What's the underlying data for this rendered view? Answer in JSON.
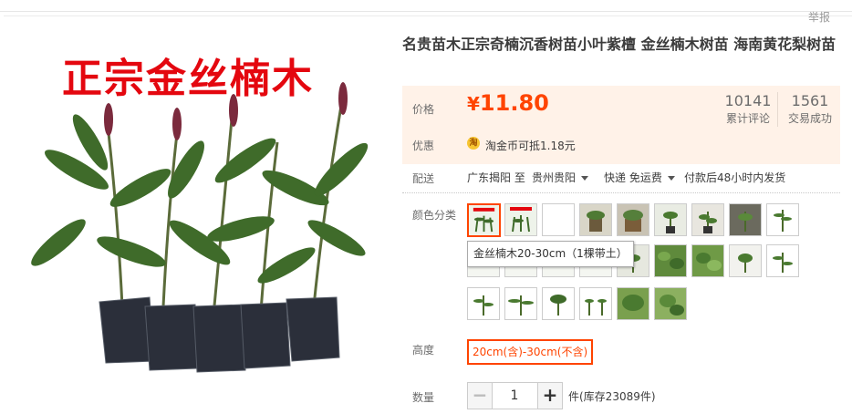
{
  "header": {
    "report_label": "举报"
  },
  "product_image": {
    "overlay_text": "正宗金丝楠木",
    "title_color": "#e4070f"
  },
  "product": {
    "title": "名贵苗木正宗奇楠沉香树苗小叶紫檀 金丝楠木树苗 海南黄花梨树苗"
  },
  "price": {
    "label": "价格",
    "currency_symbol": "¥",
    "value": "11.80",
    "color": "#ff4400"
  },
  "stats": {
    "reviews_count": "10141",
    "reviews_label": "累计评论",
    "sales_count": "1561",
    "sales_label": "交易成功"
  },
  "promo": {
    "label": "优惠",
    "coin_icon_text": "淘",
    "text": "淘金币可抵1.18元"
  },
  "shipping": {
    "label": "配送",
    "from": "广东揭阳 至",
    "to": "贵州贵阳",
    "method": "快递 免运费",
    "delivery_note": "付款后48小时内发货"
  },
  "color_options": {
    "label": "颜色分类",
    "tooltip": "金丝楠木20-30cm（1棵带土）",
    "selected_index": 0
  },
  "height_options": {
    "label": "高度",
    "selected": "20cm(含)-30cm(不含)"
  },
  "quantity": {
    "label": "数量",
    "minus": "−",
    "plus": "+",
    "value": "1",
    "stock_text": "件(库存23089件)"
  }
}
